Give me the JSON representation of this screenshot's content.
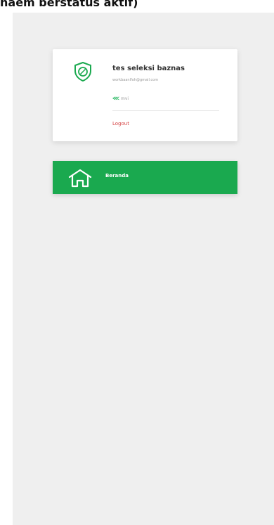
{
  "caption": "naem berstatus aktif)",
  "profile": {
    "name": "tes seleksi baznas",
    "email": "workbaanlfoh@gmail.com",
    "balance_label": "mvi",
    "logout_label": "Logout"
  },
  "menu": {
    "items": [
      {
        "label": "Beranda",
        "icon": "home-icon",
        "active": true
      }
    ]
  },
  "colors": {
    "accent": "#1aa94f",
    "logout": "#d64545",
    "background": "#efefef"
  }
}
